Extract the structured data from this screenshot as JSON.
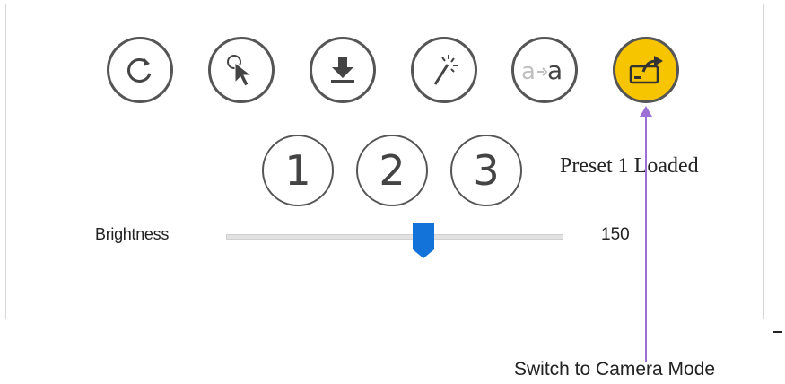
{
  "toolbar": {
    "buttons": [
      {
        "name": "refresh-button",
        "icon": "rotate-icon"
      },
      {
        "name": "select-button",
        "icon": "cursor-icon"
      },
      {
        "name": "download-button",
        "icon": "download-icon"
      },
      {
        "name": "magic-wand-button",
        "icon": "magic-wand-icon"
      },
      {
        "name": "text-replace-button",
        "icon": "text-replace-icon",
        "icon_text_left": "a",
        "icon_text_right": "a"
      },
      {
        "name": "camera-mode-button",
        "icon": "camera-switch-icon",
        "active": true
      }
    ],
    "active_color": "#f7c500"
  },
  "presets": {
    "labels": [
      "1",
      "2",
      "3"
    ],
    "status": "Preset 1 Loaded"
  },
  "brightness": {
    "label": "Brightness",
    "value": "150",
    "level_fraction": 0.585
  },
  "annotation": {
    "caption": "Switch to Camera Mode",
    "arrow_color": "#9b6fd6"
  }
}
